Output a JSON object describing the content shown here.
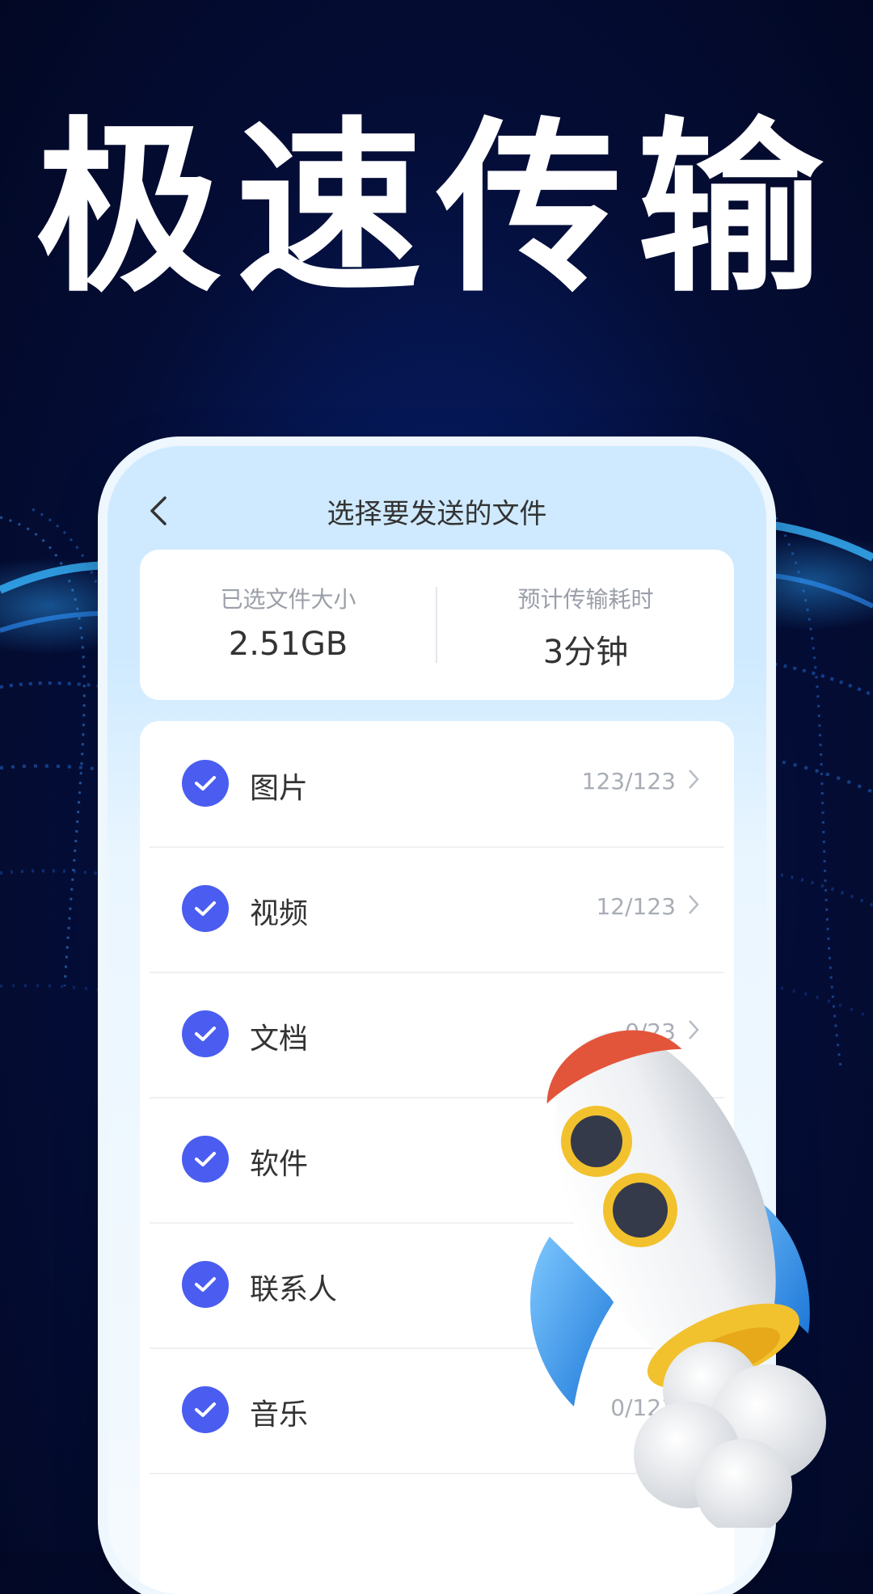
{
  "headline": "极速传输",
  "screen": {
    "title": "选择要发送的文件",
    "summary": {
      "selected_size_label": "已选文件大小",
      "selected_size_value": "2.51GB",
      "eta_label": "预计传输耗时",
      "eta_value": "3分钟"
    },
    "items": [
      {
        "label": "图片",
        "count": "123/123"
      },
      {
        "label": "视频",
        "count": "12/123"
      },
      {
        "label": "文档",
        "count": "0/23"
      },
      {
        "label": "软件",
        "count": ""
      },
      {
        "label": "联系人",
        "count": ""
      },
      {
        "label": "音乐",
        "count": "0/123"
      }
    ]
  },
  "colors": {
    "accent": "#4a5df0",
    "background": "#040d36",
    "header": "#cfeaff"
  }
}
